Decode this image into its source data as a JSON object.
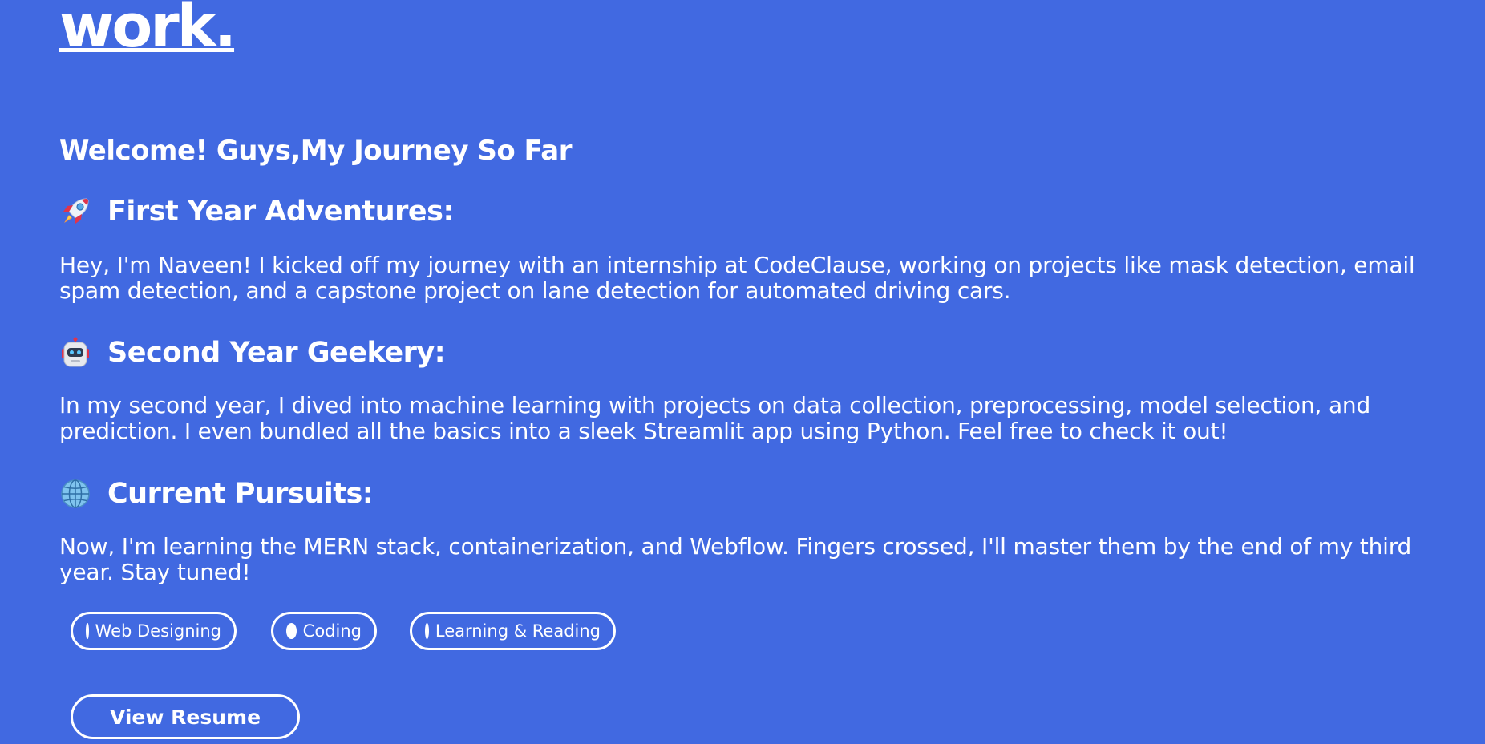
{
  "brand": {
    "logo_text": "work."
  },
  "intro": {
    "welcome": "Welcome! Guys,My Journey So Far"
  },
  "sections": [
    {
      "icon": "rocket-icon",
      "title": "First Year Adventures:",
      "text": "Hey, I'm Naveen! I kicked off my journey with an internship at CodeClause, working on projects like mask detection, email spam detection, and a capstone project on lane detection for automated driving cars."
    },
    {
      "icon": "robot-icon",
      "title": "Second Year Geekery:",
      "text": "In my second year, I dived into machine learning with projects on data collection, preprocessing, model selection, and prediction. I even bundled all the basics into a sleek Streamlit app using Python. Feel free to check it out!"
    },
    {
      "icon": "globe-icon",
      "title": "Current Pursuits:",
      "text": "Now, I'm learning the MERN stack, containerization, and Webflow. Fingers crossed, I'll master them by the end of my third year. Stay tuned!"
    }
  ],
  "tags": [
    {
      "label": "Web Designing"
    },
    {
      "label": "Coding"
    },
    {
      "label": "Learning & Reading"
    }
  ],
  "actions": {
    "view_resume": "View Resume"
  },
  "colors": {
    "background": "#4169e1",
    "text": "#ffffff"
  }
}
